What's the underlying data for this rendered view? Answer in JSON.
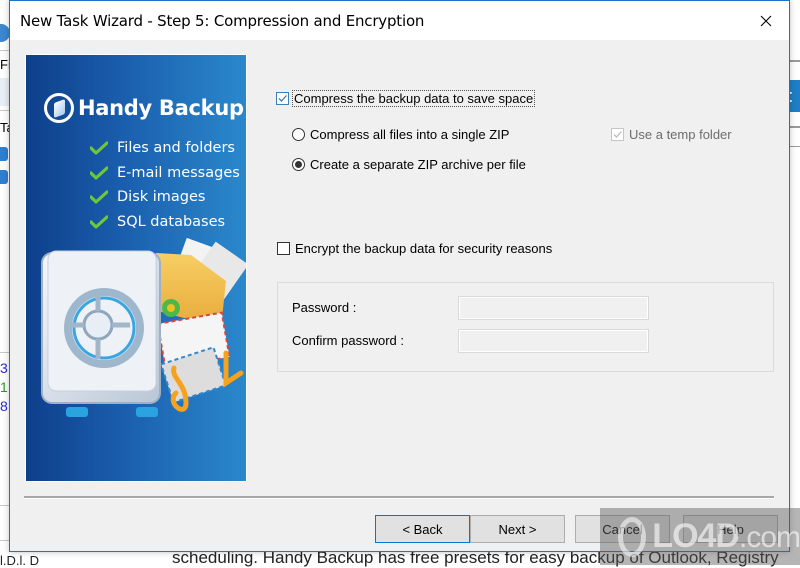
{
  "dialog": {
    "title": "New Task Wizard - Step 5: Compression and Encryption",
    "close_icon": "close-icon"
  },
  "banner": {
    "brand_name": "Handy Backup",
    "features": [
      {
        "label": "Files and folders",
        "icon": "checkmark-icon"
      },
      {
        "label": "E-mail messages",
        "icon": "checkmark-icon"
      },
      {
        "label": "Disk images",
        "icon": "checkmark-icon"
      },
      {
        "label": "SQL databases",
        "icon": "checkmark-icon"
      }
    ]
  },
  "compression": {
    "compress_label": "Compress the backup data to save space",
    "compress_checked": true,
    "options": [
      {
        "label": "Compress all files into a single ZIP",
        "selected": false
      },
      {
        "label": "Create a separate ZIP archive per file",
        "selected": true
      }
    ],
    "temp_folder_label": "Use a temp folder",
    "temp_folder_checked": true,
    "temp_folder_enabled": false
  },
  "encryption": {
    "encrypt_label": "Encrypt the backup data for security reasons",
    "encrypt_checked": false,
    "password_label": "Password :",
    "password_value": "",
    "confirm_label": "Confirm password :",
    "confirm_value": ""
  },
  "buttons": {
    "back": "< Back",
    "next": "Next >",
    "cancel": "Cancel",
    "help": "Help"
  },
  "background": {
    "left_texts": [
      "Fi",
      "Ta"
    ],
    "left_numbers": [
      "3",
      "1",
      "8"
    ],
    "right_badge": "t",
    "bottom_text": "scheduling. Handy Backup has free presets for easy backup of Outlook, Registry",
    "bottom_left_text": "l.D.l. D"
  },
  "watermark": {
    "text": "LO4D",
    "suffix": ".com"
  },
  "colors": {
    "accent": "#0078d7",
    "banner_dark": "#0e3f8a",
    "banner_light": "#2b88cc",
    "check_green": "#5cb531"
  }
}
